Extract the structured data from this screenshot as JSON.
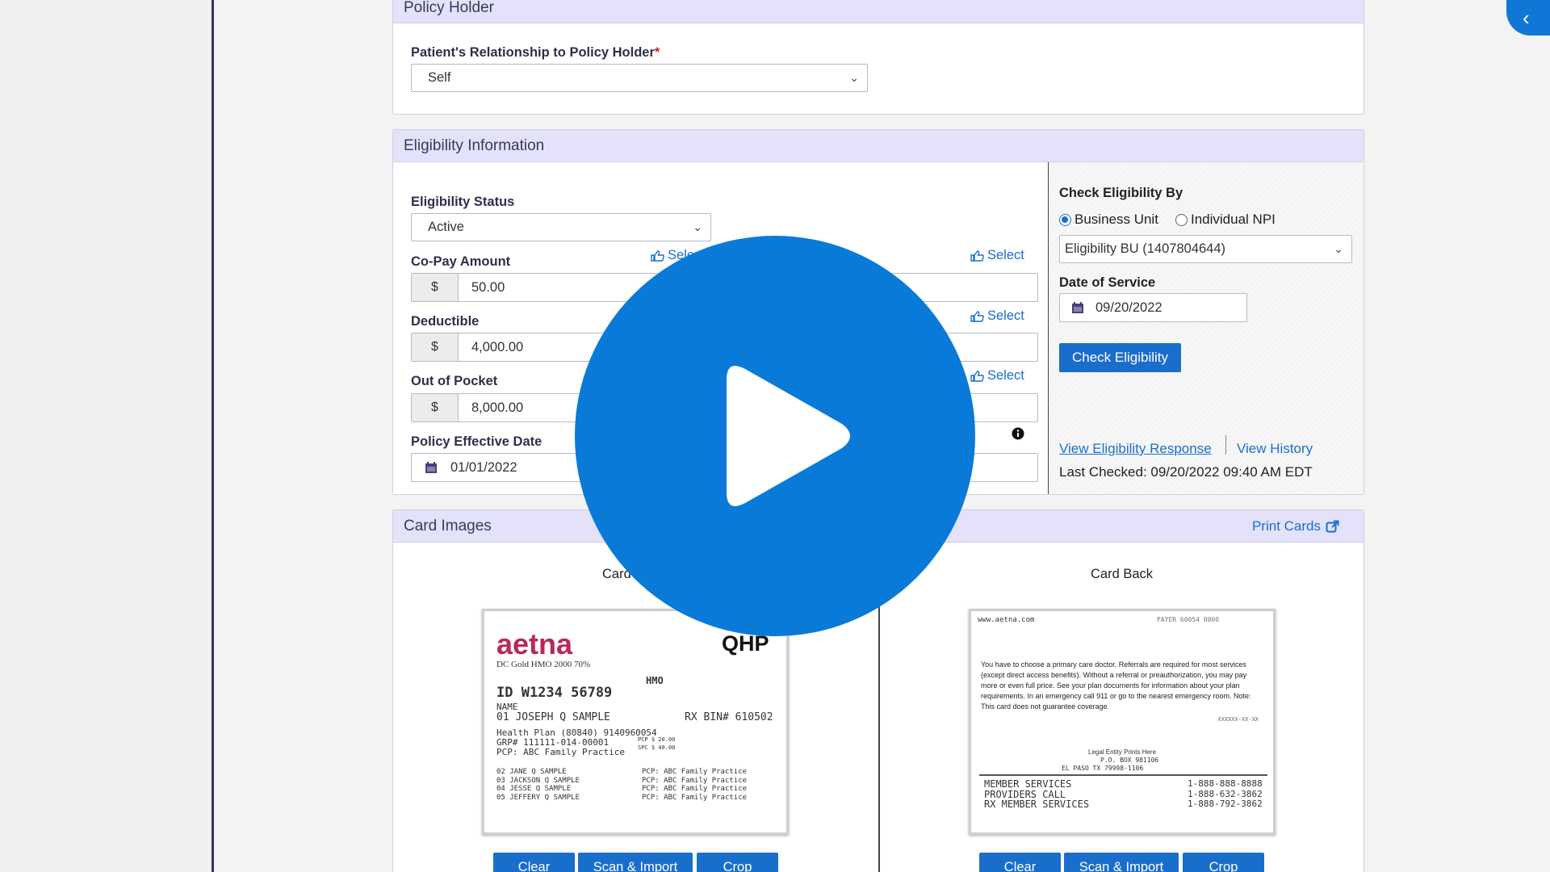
{
  "policy_holder": {
    "title": "Policy Holder",
    "relationship_label": "Patient's Relationship to Policy Holder",
    "required_mark": "*",
    "relationship_value": "Self"
  },
  "eligibility": {
    "title": "Eligibility Information",
    "status_label": "Eligibility Status",
    "status_value": "Active",
    "copay_label": "Co-Pay Amount",
    "copay_currency": "$",
    "copay_value": "50.00",
    "copay_percent": "%",
    "select_label": "Select",
    "select_partial": "Sele",
    "deductible_label": "Deductible",
    "deductible_currency": "$",
    "deductible_value": "4,000.00",
    "oop_label": "Out of Pocket",
    "oop_currency": "$",
    "oop_value": "8,000.00",
    "effective_date_label": "Policy Effective Date",
    "effective_date_value": "01/01/2022",
    "check_by_label": "Check Eligibility By",
    "radio_business_unit": "Business Unit",
    "radio_individual_npi": "Individual NPI",
    "bu_select_value": "Eligibility BU (1407804644)",
    "dos_label": "Date of Service",
    "dos_value": "09/20/2022",
    "check_button": "Check Eligibility",
    "view_response_link": "View Eligibility Response",
    "view_history_link": "View History",
    "last_checked": "Last Checked: 09/20/2022 09:40 AM EDT"
  },
  "cards": {
    "title": "Card Images",
    "print_link": "Print Cards",
    "front_title": "Card",
    "back_title": "Card Back",
    "front": {
      "brand": "aetna",
      "plan": "DC Gold HMO 2000 70%",
      "qhp": "QHP",
      "hmo": "HMO",
      "id_line": "ID  W1234 56789",
      "name_label": "NAME",
      "member_line": "01 JOSEPH Q SAMPLE",
      "rx_bin": "RX BIN# 610502",
      "health_plan": "Health Plan (80840) 9140960054",
      "grp": "GRP# 111111-014-00001",
      "pcp": "PCP: ABC Family Practice",
      "dependents": [
        "02 JANE Q SAMPLE",
        "03 JACKSON Q SAMPLE",
        "04 JESSE Q SAMPLE",
        "05 JEFFERY Q SAMPLE"
      ],
      "dependent_pcps": [
        "PCP: ABC Family Practice",
        "PCP: ABC Family Practice",
        "PCP: ABC Family Practice",
        "PCP: ABC Family Practice"
      ],
      "copays": [
        "PCP $ 20.00",
        "SPC $ 40.00"
      ]
    },
    "back": {
      "url": "www.aetna.com",
      "paper": "PAYER 60054 0000",
      "body": "You have to choose a primary care doctor. Referrals are required for most services (except direct access benefits). Without a referral or preauthorization, you may pay more or even full price. See your plan documents for information about your plan requirements. In an emergency call 911 or go to the nearest emergency room. Note: This card does not guarantee coverage.",
      "code": "XXXXXX-XX-XX",
      "entity": "Legal Entity Prints Here",
      "po_box": "P.O. BOX 981106",
      "city": "EL PASO        TX 79998-1106",
      "services": [
        {
          "label": "MEMBER SERVICES",
          "phone": "1-888-888-8888"
        },
        {
          "label": "PROVIDERS CALL",
          "phone": "1-888-632-3862"
        },
        {
          "label": "RX MEMBER SERVICES",
          "phone": "1-888-792-3862"
        }
      ]
    },
    "buttons": {
      "clear": "Clear",
      "scan": "Scan & Import",
      "crop": "Crop"
    }
  },
  "icons": {
    "collapse": "chevron-left-icon",
    "calendar": "calendar-icon",
    "pointer": "hand-pointer-icon",
    "external": "external-link-icon",
    "info": "info-icon",
    "play": "play-icon"
  },
  "colors": {
    "accent": "#1a6ecb",
    "header_bg": "#e3e2fa",
    "play": "#0a7ad8",
    "rail": "#3e2a7a"
  }
}
